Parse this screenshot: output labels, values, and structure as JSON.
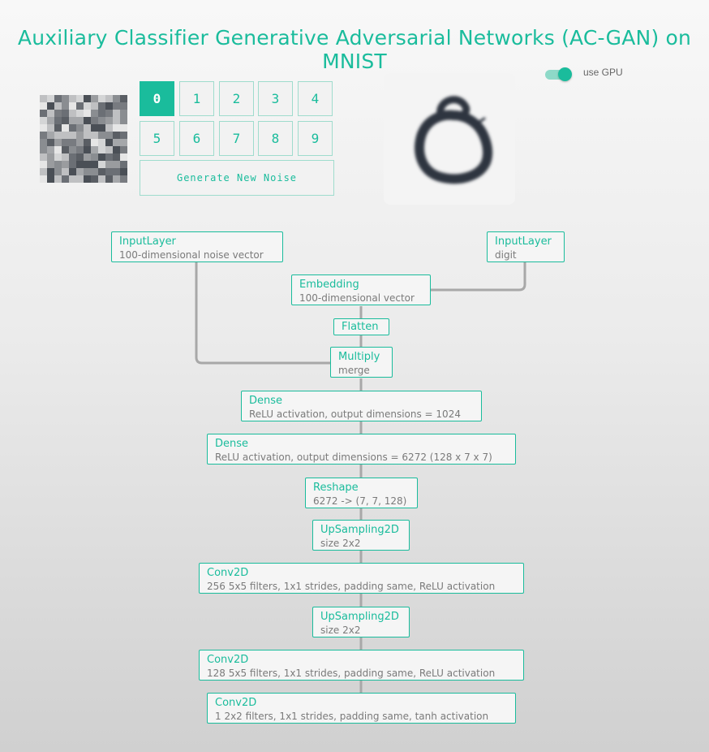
{
  "title": "Auxiliary Classifier Generative Adversarial Networks (AC-GAN) on MNIST",
  "gpu_toggle": {
    "label": "use GPU",
    "checked": true
  },
  "digits": [
    "0",
    "1",
    "2",
    "3",
    "4",
    "5",
    "6",
    "7",
    "8",
    "9"
  ],
  "selected_digit": "0",
  "generate_label": "Generate New Noise",
  "colors": {
    "accent": "#1abc9c",
    "wire": "#a8a8a8"
  },
  "layers": {
    "input_noise": {
      "name": "InputLayer",
      "desc": "100-dimensional noise vector"
    },
    "input_digit": {
      "name": "InputLayer",
      "desc": "digit"
    },
    "embedding": {
      "name": "Embedding",
      "desc": "100-dimensional vector"
    },
    "flatten": {
      "name": "Flatten"
    },
    "multiply": {
      "name": "Multiply",
      "desc": "merge"
    },
    "dense1": {
      "name": "Dense",
      "desc": "ReLU activation, output dimensions = 1024"
    },
    "dense2": {
      "name": "Dense",
      "desc": "ReLU activation, output dimensions = 6272 (128 x 7 x 7)"
    },
    "reshape": {
      "name": "Reshape",
      "desc": "6272 -> (7, 7, 128)"
    },
    "upsampling1": {
      "name": "UpSampling2D",
      "desc": "size 2x2"
    },
    "conv1": {
      "name": "Conv2D",
      "desc": "256 5x5 filters, 1x1 strides, padding same, ReLU activation"
    },
    "upsampling2": {
      "name": "UpSampling2D",
      "desc": "size 2x2"
    },
    "conv2": {
      "name": "Conv2D",
      "desc": "128 5x5 filters, 1x1 strides, padding same, ReLU activation"
    },
    "conv3": {
      "name": "Conv2D",
      "desc": "1 2x2 filters, 1x1 strides, padding same, tanh activation"
    }
  }
}
